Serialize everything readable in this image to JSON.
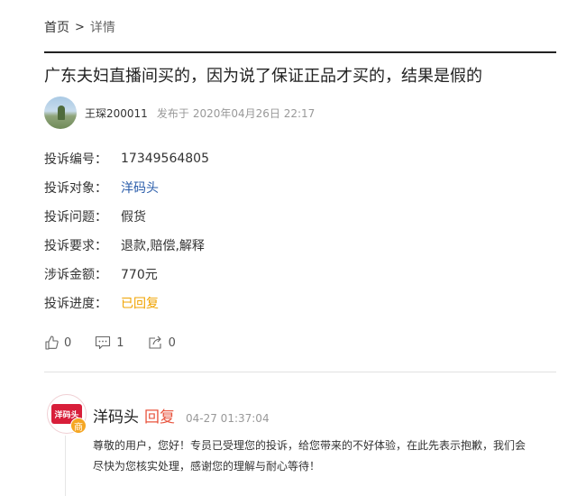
{
  "breadcrumb": {
    "home": "首页",
    "separator": ">",
    "current": "详情"
  },
  "title": "广东夫妇直播间买的，因为说了保证正品才买的，结果是假的",
  "author": {
    "name": "王琛200011",
    "publish_prefix": "发布于",
    "publish_time": "2020年04月26日 22:17"
  },
  "info": [
    {
      "label": "投诉编号：",
      "value": "17349564805"
    },
    {
      "label": "投诉对象：",
      "value": "洋码头"
    },
    {
      "label": "投诉问题：",
      "value": "假货"
    },
    {
      "label": "投诉要求：",
      "value": "退款,赔偿,解释"
    },
    {
      "label": "涉诉金额：",
      "value": "770元"
    },
    {
      "label": "投诉进度：",
      "value": "已回复"
    }
  ],
  "actions": {
    "like_count": "0",
    "comment_count": "1",
    "share_count": "0"
  },
  "reply": {
    "logo_text": "洋码头",
    "badge": "商",
    "name": "洋码头",
    "tag": "回复",
    "time": "04-27 01:37:04",
    "text": "尊敬的用户，您好！专员已受理您的投诉，给您带来的不好体验，在此先表示抱歉，我们会尽快为您核实处理，感谢您的理解与耐心等待！"
  },
  "colors": {
    "link": "#2a5caa",
    "status": "#f0a300",
    "reply_tag": "#e8553f",
    "brand": "#d81e3a"
  }
}
